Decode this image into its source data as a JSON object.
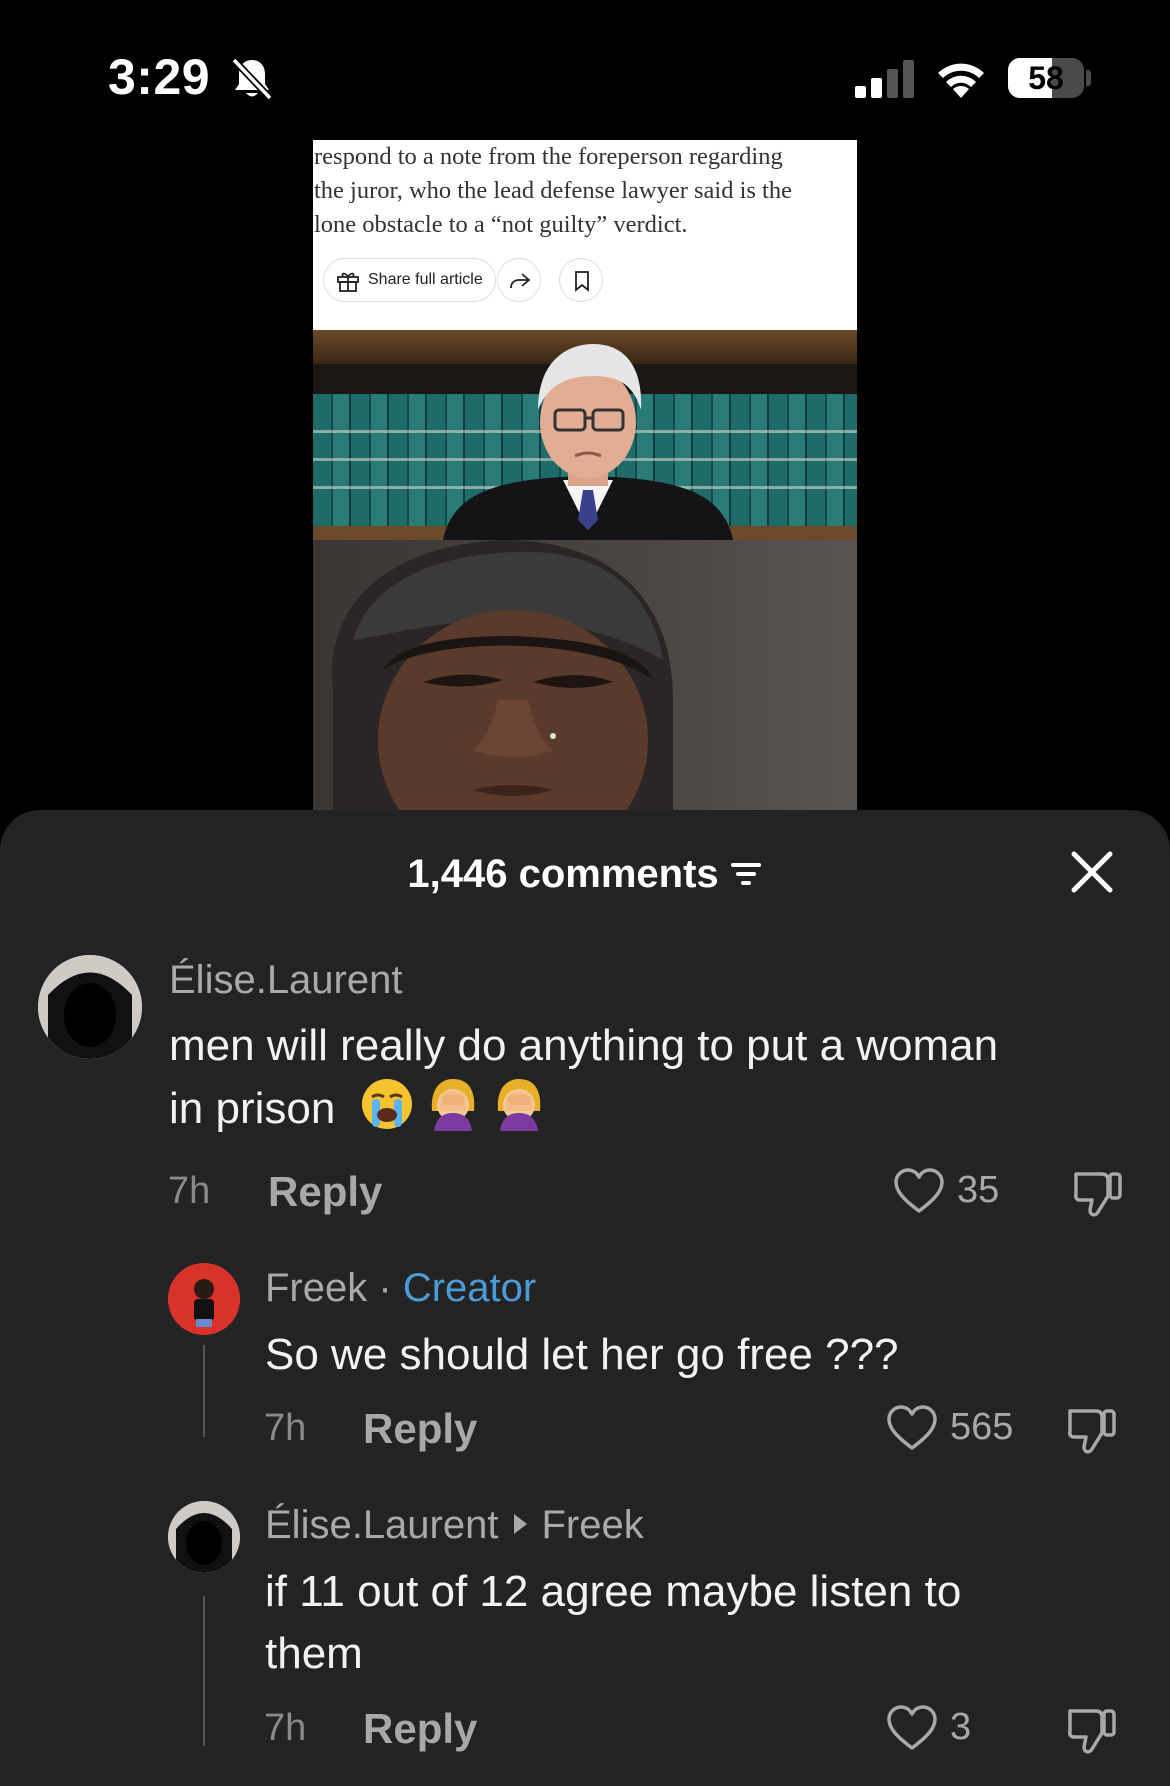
{
  "status_bar": {
    "time": "3:29",
    "battery": "58",
    "battery_level": 0.58,
    "signal_bars_active": 2,
    "signal_bars_total": 4,
    "icons": [
      "bell-slash-icon",
      "signal-icon",
      "wifi-icon",
      "battery-icon"
    ]
  },
  "article": {
    "text_lines": [
      "respond to a note from the foreperson regarding",
      "the juror, who the lead defense lawyer said is the",
      "lone obstacle to a “not guilty” verdict."
    ],
    "share_label": "Share full article",
    "icons": [
      "gift-icon",
      "share-arrow-icon",
      "bookmark-icon"
    ]
  },
  "comments_panel": {
    "title": "1,446 comments",
    "icons": [
      "filter-icon",
      "close-icon"
    ],
    "comments": [
      {
        "username": "Élise.Laurent",
        "text_line1": "men will really do anything to put a woman",
        "text_line2": "in prison",
        "emojis": [
          "loudly-crying-face-emoji",
          "woman-facepalming-emoji",
          "woman-facepalming-emoji"
        ],
        "time": "7h",
        "reply_label": "Reply",
        "likes": "35"
      },
      {
        "username": "Freek",
        "separator": "·",
        "badge": "Creator",
        "text": "So we should let her go free ???",
        "time": "7h",
        "reply_label": "Reply",
        "likes": "565"
      },
      {
        "username": "Élise.Laurent",
        "reply_to": "Freek",
        "text_line1": "if 11 out of 12 agree maybe listen to",
        "text_line2": "them",
        "time": "7h",
        "reply_label": "Reply",
        "likes": "3"
      }
    ]
  },
  "colors": {
    "sheet_background": "#232323",
    "creator_badge": "#4a9bd6",
    "muted_text": "#a8a8a8",
    "primary_text": "#f2f2f2"
  }
}
